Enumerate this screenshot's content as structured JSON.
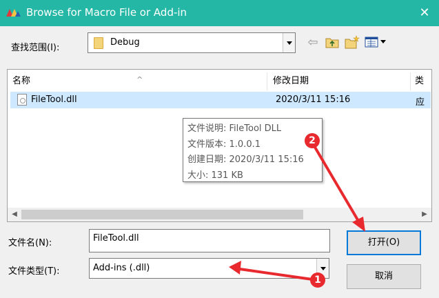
{
  "window": {
    "title": "Browse for Macro File or Add-in",
    "close_glyph": "✕"
  },
  "lookin": {
    "label": "查找范围(I):",
    "value": "Debug"
  },
  "toolbar": {
    "icons": [
      "back-icon",
      "up-folder-icon",
      "new-folder-icon",
      "view-menu-icon"
    ],
    "back_glyph": "⇦"
  },
  "columns": [
    {
      "label": "名称"
    },
    {
      "label": "修改日期"
    },
    {
      "label": "类"
    }
  ],
  "files": [
    {
      "name": "FileTool.dll",
      "modified": "2020/3/11 15:16",
      "type": "应"
    }
  ],
  "tooltip": {
    "lines": [
      "文件说明: FileTool DLL",
      "文件版本: 1.0.0.1",
      "创建日期: 2020/3/11 15:16",
      "大小: 131 KB"
    ]
  },
  "filename": {
    "label": "文件名(N):",
    "value": "FileTool.dll"
  },
  "filetype": {
    "label": "文件类型(T):",
    "value": "Add-ins (.dll)"
  },
  "buttons": {
    "open": "打开(O)",
    "cancel": "取消"
  },
  "annotations": [
    {
      "number": "1"
    },
    {
      "number": "2"
    }
  ],
  "colors": {
    "titlebar": "#25b7a5",
    "selection": "#cde8ff",
    "focus_border": "#0078d7",
    "annotation_red": "#e8292e"
  }
}
